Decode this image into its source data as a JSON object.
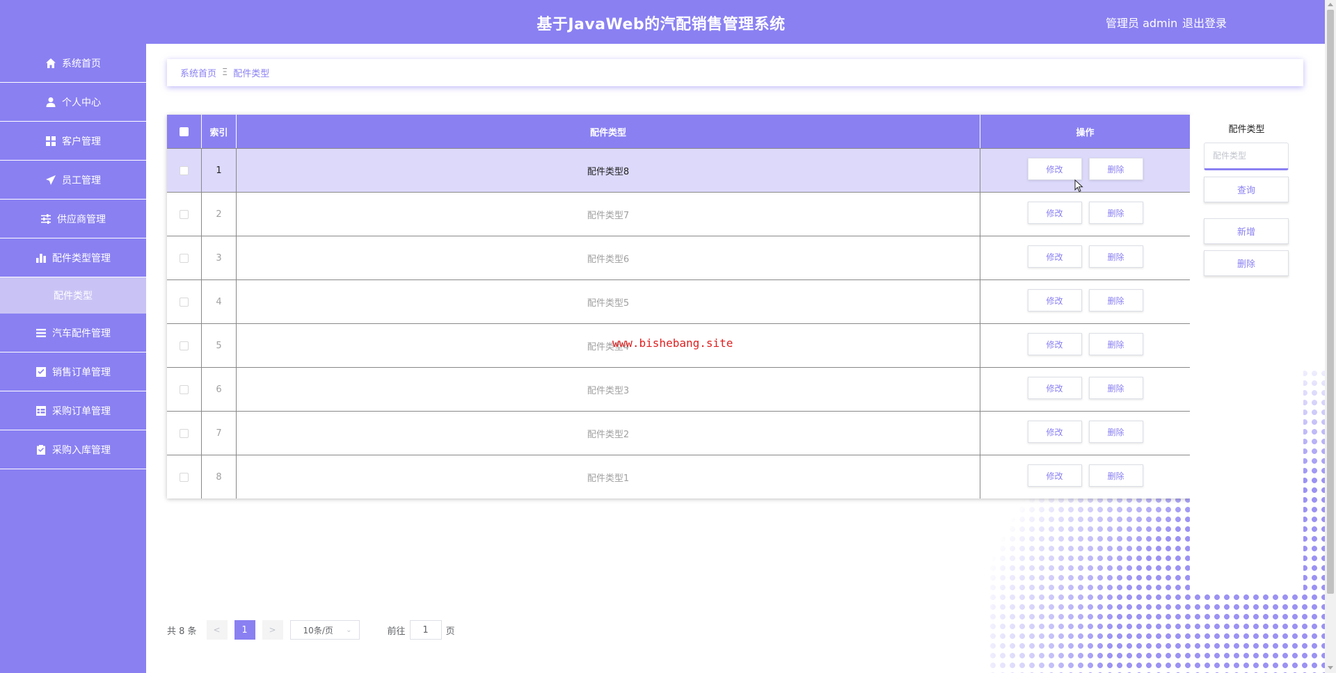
{
  "header": {
    "title": "基于JavaWeb的汽配销售管理系统",
    "user": "管理员 admin",
    "logout": "退出登录"
  },
  "sidebar": {
    "items": [
      {
        "label": "系统首页",
        "icon": "home-icon"
      },
      {
        "label": "个人中心",
        "icon": "user-icon"
      },
      {
        "label": "客户管理",
        "icon": "grid-icon"
      },
      {
        "label": "员工管理",
        "icon": "send-icon"
      },
      {
        "label": "供应商管理",
        "icon": "sliders-icon"
      },
      {
        "label": "配件类型管理",
        "icon": "bar-chart-icon"
      },
      {
        "label": "汽车配件管理",
        "icon": "list-icon"
      },
      {
        "label": "销售订单管理",
        "icon": "check-square-icon"
      },
      {
        "label": "采购订单管理",
        "icon": "table-icon"
      },
      {
        "label": "采购入库管理",
        "icon": "clipboard-icon"
      }
    ],
    "active_sub": "配件类型"
  },
  "breadcrumb": {
    "home": "系统首页",
    "separator": "Ξ",
    "current": "配件类型"
  },
  "table": {
    "headers": {
      "index": "索引",
      "type": "配件类型",
      "ops": "操作"
    },
    "edit_label": "修改",
    "delete_label": "删除",
    "rows": [
      {
        "index": "1",
        "type": "配件类型8"
      },
      {
        "index": "2",
        "type": "配件类型7"
      },
      {
        "index": "3",
        "type": "配件类型6"
      },
      {
        "index": "4",
        "type": "配件类型5"
      },
      {
        "index": "5",
        "type": "配件类型4"
      },
      {
        "index": "6",
        "type": "配件类型3"
      },
      {
        "index": "7",
        "type": "配件类型2"
      },
      {
        "index": "8",
        "type": "配件类型1"
      }
    ]
  },
  "search_panel": {
    "label": "配件类型",
    "placeholder": "配件类型",
    "search": "查询",
    "add": "新增",
    "delete": "删除"
  },
  "pagination": {
    "total": "共 8 条",
    "prev": "<",
    "current_page": "1",
    "next": ">",
    "page_size": "10条/页",
    "goto_prefix": "前往",
    "goto_value": "1",
    "goto_suffix": "页"
  },
  "watermark": "www.bishebang.site",
  "colors": {
    "accent": "#8a80f2",
    "highlight_row": "#dcd9fb"
  }
}
